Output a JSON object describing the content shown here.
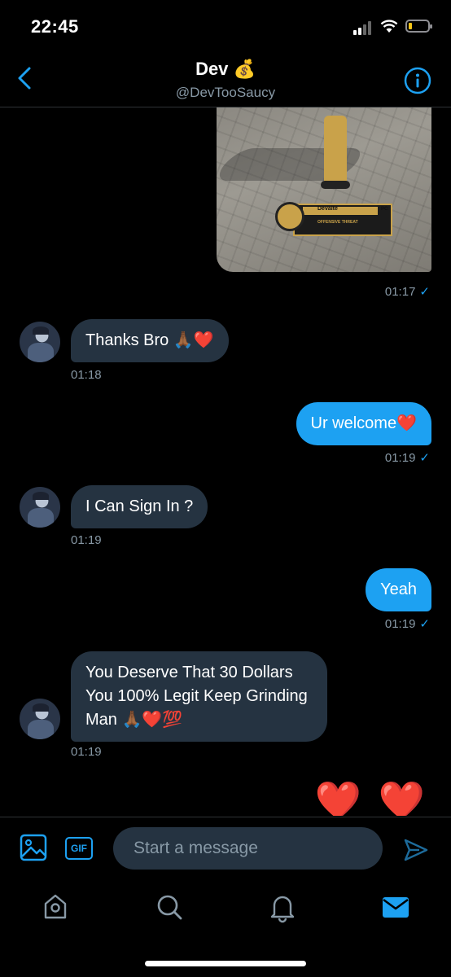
{
  "status_bar": {
    "time": "22:45",
    "battery_level": 0.1
  },
  "header": {
    "name": "Dev 💰",
    "handle": "@DevTooSaucy"
  },
  "messages": [
    {
      "type": "image",
      "direction": "outgoing",
      "time": "01:17",
      "image_text": [
        "Devalte",
        "PC",
        "OFFENSIVE THREAT"
      ]
    },
    {
      "type": "text",
      "direction": "incoming",
      "text": "Thanks Bro 🙏🏾❤️",
      "time": "01:18"
    },
    {
      "type": "text",
      "direction": "outgoing",
      "text": "Ur welcome❤️",
      "time": "01:19"
    },
    {
      "type": "text",
      "direction": "incoming",
      "text": "I Can Sign In ?",
      "time": "01:19"
    },
    {
      "type": "text",
      "direction": "outgoing",
      "text": "Yeah",
      "time": "01:19"
    },
    {
      "type": "text",
      "direction": "incoming",
      "lines": [
        "You Deserve That 30 Dollars",
        "You 100% Legit Keep Grinding",
        "Man 🙏🏾❤️💯"
      ],
      "time": "01:19"
    },
    {
      "type": "emoji",
      "direction": "outgoing",
      "text": "❤️ ❤️"
    }
  ],
  "composer": {
    "placeholder": "Start a message",
    "gif_label": "GIF"
  },
  "tabs": [
    {
      "name": "home-icon"
    },
    {
      "name": "search-icon"
    },
    {
      "name": "bell-icon"
    },
    {
      "name": "mail-icon",
      "active": true
    }
  ],
  "colors": {
    "accent": "#1da1f2",
    "bubble_in": "#253341",
    "muted": "#8899a6",
    "background": "#000000"
  }
}
